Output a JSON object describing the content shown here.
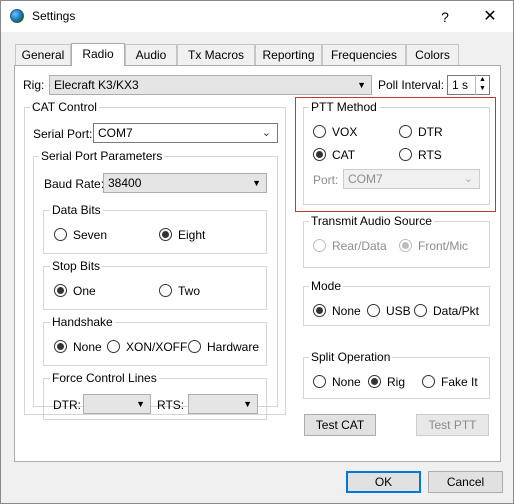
{
  "window": {
    "title": "Settings",
    "help_glyph": "?",
    "close_glyph": "✕"
  },
  "tabs": [
    "General",
    "Radio",
    "Audio",
    "Tx Macros",
    "Reporting",
    "Frequencies",
    "Colors"
  ],
  "rig": {
    "label": "Rig:",
    "value": "Elecraft K3/KX3",
    "poll_label": "Poll Interval:",
    "poll_value": "1 s"
  },
  "cat_control": {
    "title": "CAT Control",
    "serial_port_label": "Serial Port:",
    "serial_port_value": "COM7",
    "params_title": "Serial Port Parameters",
    "baud_label": "Baud Rate:",
    "baud_value": "38400",
    "data_bits": {
      "title": "Data Bits",
      "options": [
        "Seven",
        "Eight"
      ],
      "selected": "Eight"
    },
    "stop_bits": {
      "title": "Stop Bits",
      "options": [
        "One",
        "Two"
      ],
      "selected": "One"
    },
    "handshake": {
      "title": "Handshake",
      "options": [
        "None",
        "XON/XOFF",
        "Hardware"
      ],
      "selected": "None"
    },
    "force_lines": {
      "title": "Force Control Lines",
      "dtr_label": "DTR:",
      "rts_label": "RTS:",
      "dtr_value": "",
      "rts_value": ""
    }
  },
  "ptt_method": {
    "title": "PTT Method",
    "options": [
      "VOX",
      "DTR",
      "CAT",
      "RTS"
    ],
    "selected": "CAT",
    "port_label": "Port:",
    "port_value": "COM7"
  },
  "transmit_audio": {
    "title": "Transmit Audio Source",
    "options": [
      "Rear/Data",
      "Front/Mic"
    ],
    "selected": "Front/Mic"
  },
  "mode": {
    "title": "Mode",
    "options": [
      "None",
      "USB",
      "Data/Pkt"
    ],
    "selected": "None"
  },
  "split": {
    "title": "Split Operation",
    "options": [
      "None",
      "Rig",
      "Fake It"
    ],
    "selected": "Rig"
  },
  "buttons": {
    "test_cat": "Test CAT",
    "test_ptt": "Test PTT",
    "ok": "OK",
    "cancel": "Cancel"
  },
  "colors": {
    "focus_border": "#0078d7",
    "highlight_box": "#c0392b"
  }
}
